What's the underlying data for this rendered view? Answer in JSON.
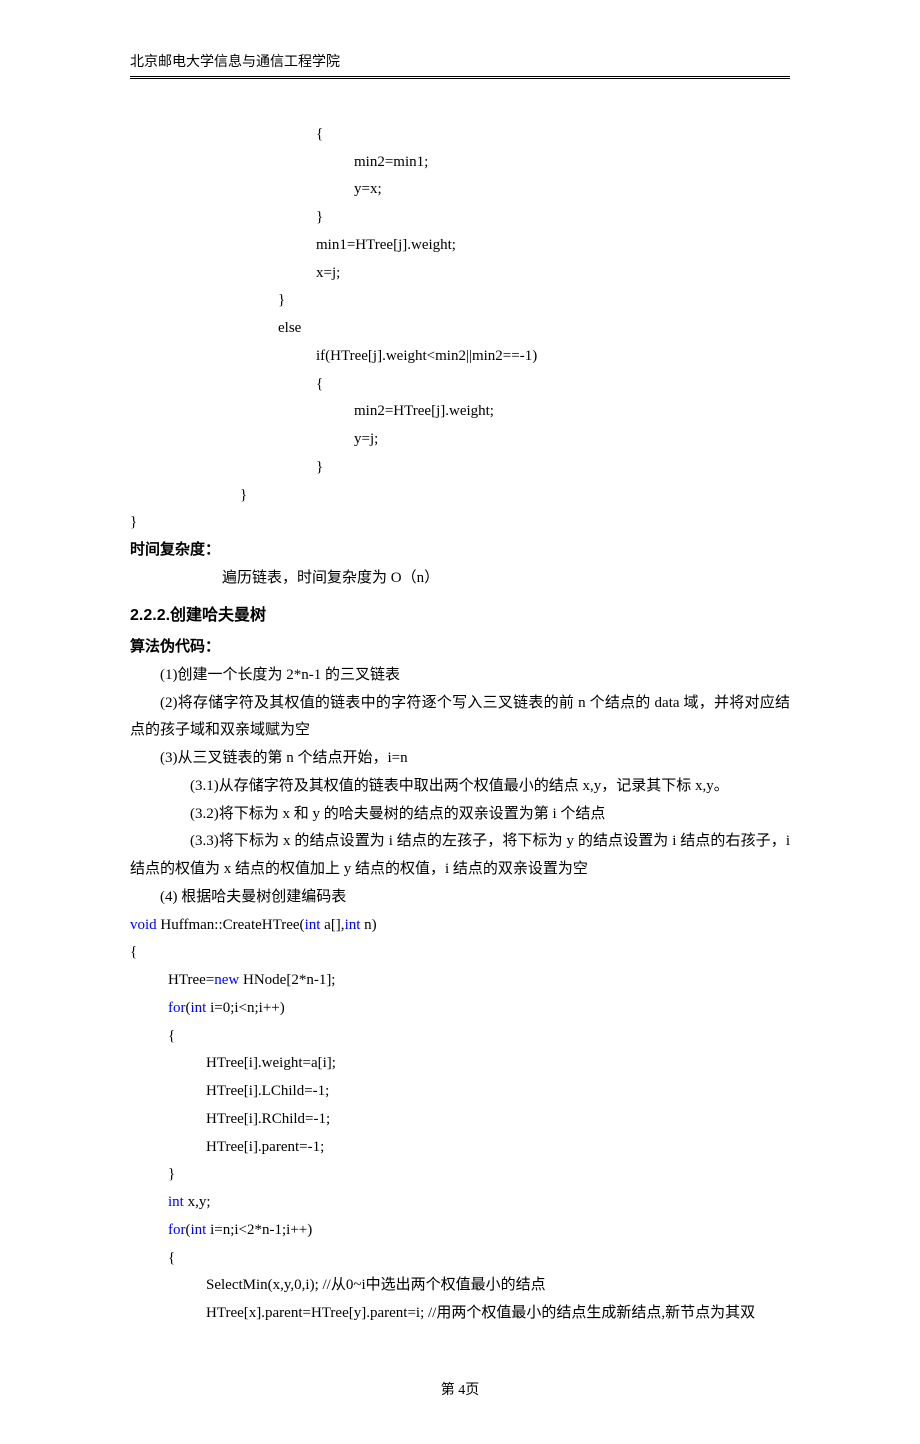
{
  "header": {
    "institution": "北京邮电大学信息与通信工程学院"
  },
  "code1": {
    "l1": "{",
    "l2": "min2=min1;",
    "l3": "y=x;",
    "l4": "}",
    "l5": "min1=HTree[j].weight;",
    "l6": "x=j;",
    "l7": "}",
    "l8": "else",
    "l9": "if(HTree[j].weight<min2||min2==-1)",
    "l10": "{",
    "l11": "min2=HTree[j].weight;",
    "l12": "y=j;",
    "l13": "}",
    "l14": "}",
    "l15": "}"
  },
  "complexity": {
    "label": "时间复杂度：",
    "text": "遍历链表，时间复杂度为 O（n）"
  },
  "section": {
    "num": "2.2.2.",
    "title": "创建哈夫曼树"
  },
  "pseudo": {
    "label": "算法伪代码：",
    "p1": "(1)创建一个长度为 2*n-1 的三叉链表",
    "p2": "(2)将存储字符及其权值的链表中的字符逐个写入三叉链表的前 n 个结点的 data 域，并将对应结点的孩子域和双亲域赋为空",
    "p3": "(3)从三叉链表的第 n 个结点开始，i=n",
    "p3_1": "(3.1)从存储字符及其权值的链表中取出两个权值最小的结点 x,y，记录其下标 x,y。",
    "p3_2": "(3.2)将下标为 x 和 y 的哈夫曼树的结点的双亲设置为第 i 个结点",
    "p3_3": "(3.3)将下标为 x 的结点设置为 i 结点的左孩子，将下标为 y 的结点设置为 i 结点的右孩子，i 结点的权值为 x 结点的权值加上 y 结点的权值，i 结点的双亲设置为空",
    "p4": "(4) 根据哈夫曼树创建编码表"
  },
  "code2": {
    "kw_void": "void",
    "kw_int": "int",
    "kw_new": "new",
    "kw_for": "for",
    "sig_a": " Huffman::CreateHTree(",
    "sig_b": " a[],",
    "sig_c": " n)",
    "l2": "{",
    "l3a": "HTree=",
    "l3b": " HNode[2*n-1];",
    "l4a": "(",
    "l4b": " i=0;i<n;i++)",
    "l5": "{",
    "l6": "HTree[i].weight=a[i];",
    "l7": "HTree[i].LChild=-1;",
    "l8": "HTree[i].RChild=-1;",
    "l9": "HTree[i].parent=-1;",
    "l10": "}",
    "l11": " x,y;",
    "l12a": "(",
    "l12b": " i=n;i<2*n-1;i++)",
    "l13": "{",
    "l14": "SelectMin(x,y,0,i); //从0~i中选出两个权值最小的结点",
    "l15": "HTree[x].parent=HTree[y].parent=i; //用两个权值最小的结点生成新结点,新节点为其双"
  },
  "footer": {
    "page": "第 4页"
  }
}
